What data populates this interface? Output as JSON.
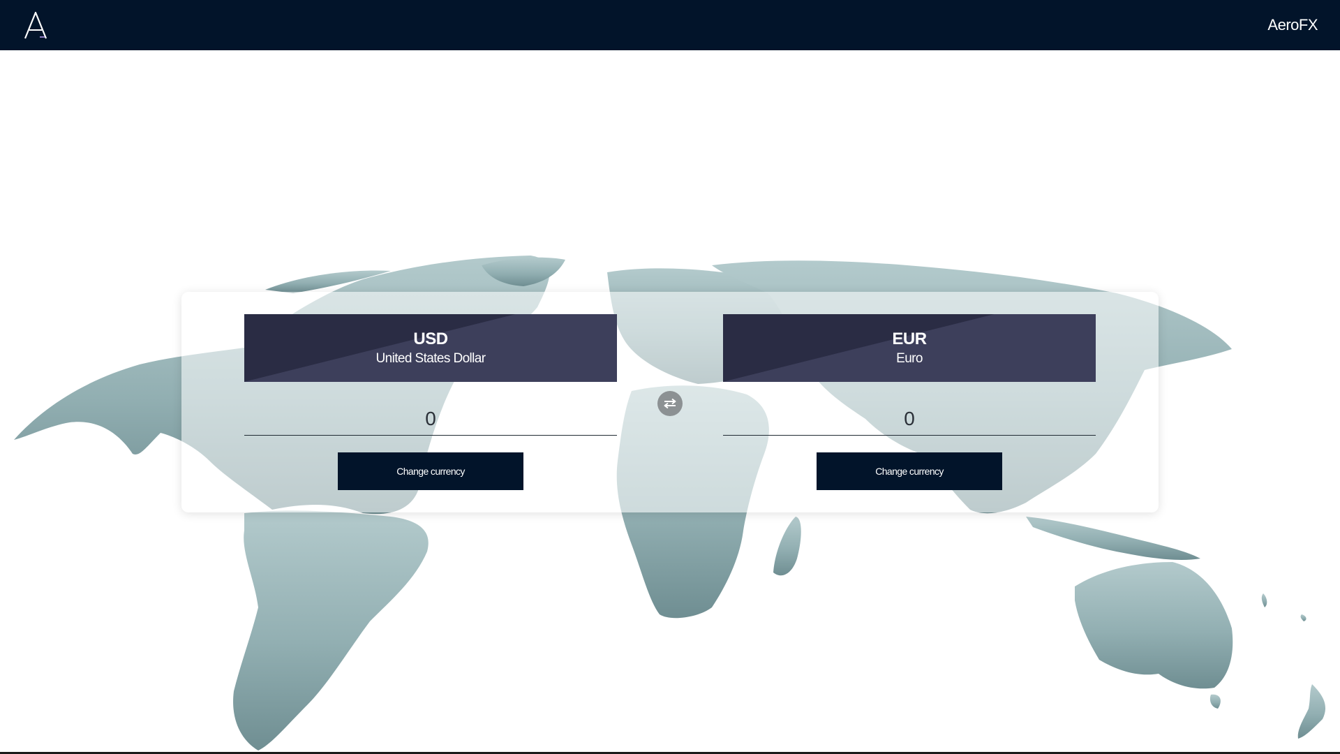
{
  "header": {
    "brand": "AeroFX",
    "logo_icon": "a-letter-logo-icon"
  },
  "colors": {
    "header_bg": "#02142a",
    "panel_header_dark": "#2a2c44",
    "panel_header_light": "#3d3f5b",
    "button_bg": "#02142a",
    "map_fill": "#7f9ea1"
  },
  "converter": {
    "swap_icon": "swap-arrows-icon",
    "from": {
      "code": "USD",
      "name": "United States Dollar",
      "amount": "0",
      "button_label": "Change currency"
    },
    "to": {
      "code": "EUR",
      "name": "Euro",
      "amount": "0",
      "button_label": "Change currency"
    }
  }
}
